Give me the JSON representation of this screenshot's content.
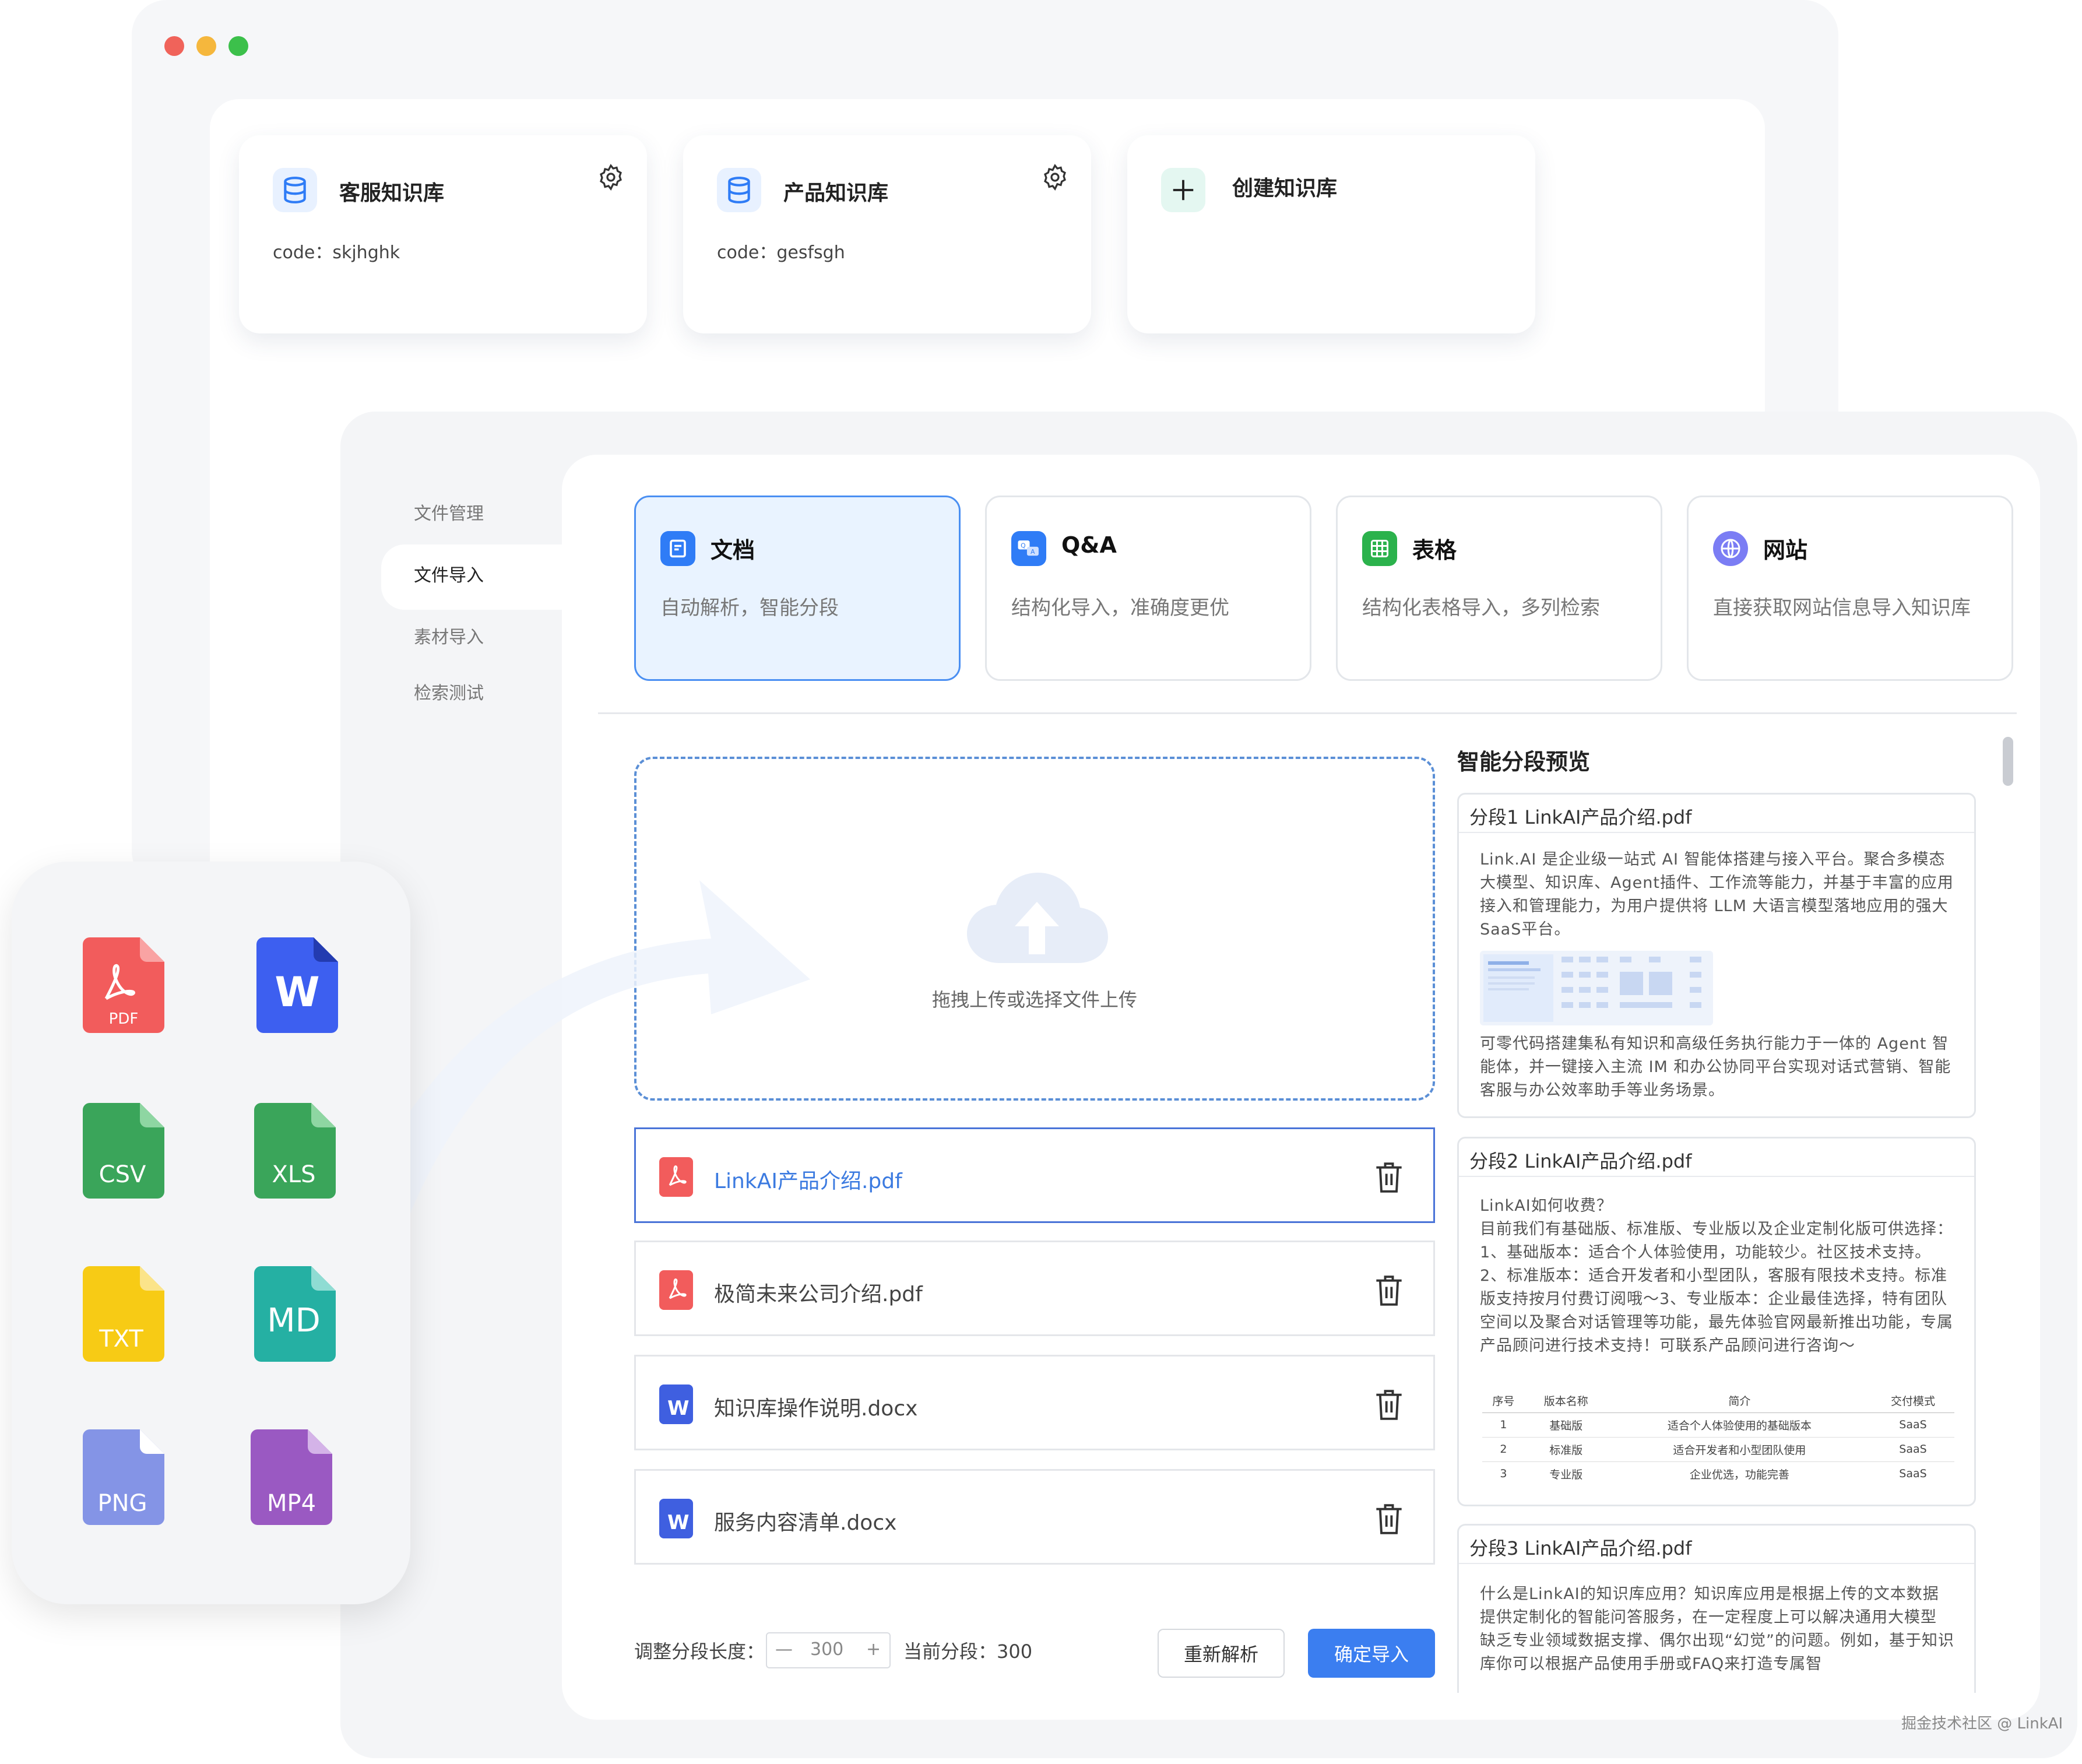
{
  "knowledge_bases": [
    {
      "title": "客服知识库",
      "code": "code：skjhghk"
    },
    {
      "title": "产品知识库",
      "code": "code：gesfsgh"
    }
  ],
  "create_kb": {
    "label": "创建知识库"
  },
  "sidebar": {
    "items": [
      {
        "label": "文件管理"
      },
      {
        "label": "文件导入"
      },
      {
        "label": "素材导入"
      },
      {
        "label": "检索测试"
      }
    ]
  },
  "import_types": [
    {
      "title": "文档",
      "desc": "自动解析，智能分段",
      "color": "#2f7cf6"
    },
    {
      "title": "Q&A",
      "desc": "结构化导入，准确度更优",
      "color": "#2f7cf6"
    },
    {
      "title": "表格",
      "desc": "结构化表格导入，多列检索",
      "color": "#2bb24c"
    },
    {
      "title": "网站",
      "desc": "直接获取网站信息导入知识库",
      "color": "#6a6cf6"
    }
  ],
  "upload": {
    "hint": "拖拽上传或选择文件上传"
  },
  "files": [
    {
      "name": "LinkAI产品介绍.pdf",
      "type": "pdf"
    },
    {
      "name": "极简未来公司介绍.pdf",
      "type": "pdf"
    },
    {
      "name": "知识库操作说明.docx",
      "type": "docx"
    },
    {
      "name": "服务内容清单.docx",
      "type": "docx"
    }
  ],
  "controls": {
    "segment_length_label": "调整分段长度：",
    "segment_length_value": "300",
    "current_segment": "当前分段：300",
    "reparse_label": "重新解析",
    "confirm_label": "确定导入"
  },
  "preview": {
    "title": "智能分段预览",
    "segments": [
      {
        "head": "分段1  LinkAI产品介绍.pdf",
        "text1": "Link.AI 是企业级一站式 AI 智能体搭建与接入平台。聚合多模态大模型、知识库、Agent插件、工作流等能力，并基于丰富的应用接入和管理能力，为用户提供将 LLM 大语言模型落地应用的强大SaaS平台。",
        "text2": "可零代码搭建集私有知识和高级任务执行能力于一体的 Agent 智能体，并一键接入主流 IM 和办公协同平台实现对话式营销、智能客服与办公效率助手等业务场景。"
      },
      {
        "head": "分段2  LinkAI产品介绍.pdf",
        "q": "LinkAI如何收费？",
        "text": "目前我们有基础版、标准版、专业版以及企业定制化版可供选择：1、基础版本：适合个人体验使用，功能较少。社区技术支持。2、标准版本：适合开发者和小型团队，客服有限技术支持。标准版支持按月付费订阅哦～3、专业版本：企业最佳选择，特有团队空间以及聚合对话管理等功能，最先体验官网最新推出功能，专属产品顾问进行技术支持！可联系产品顾问进行咨询～",
        "table": {
          "headers": [
            "序号",
            "版本名称",
            "简介",
            "交付模式"
          ],
          "rows": [
            [
              "1",
              "基础版",
              "适合个人体验使用的基础版本",
              "SaaS"
            ],
            [
              "2",
              "标准版",
              "适合开发者和小型团队使用",
              "SaaS"
            ],
            [
              "3",
              "专业版",
              "企业优选，功能完善",
              "SaaS"
            ]
          ]
        }
      },
      {
        "head": "分段3  LinkAI产品介绍.pdf",
        "text": "什么是LinkAI的知识库应用？知识库应用是根据上传的文本数据 提供定制化的智能问答服务，在一定程度上可以解决通用大模型 缺乏专业领域数据支撑、偶尔出现“幻觉”的问题。例如，基于知识库你可以根据产品使用手册或FAQ来打造专属智"
      }
    ]
  },
  "file_types": [
    "PDF",
    "W",
    "CSV",
    "XLS",
    "TXT",
    "MD",
    "PNG",
    "MP4"
  ],
  "watermark": "掘金技术社区 @ LinkAI"
}
